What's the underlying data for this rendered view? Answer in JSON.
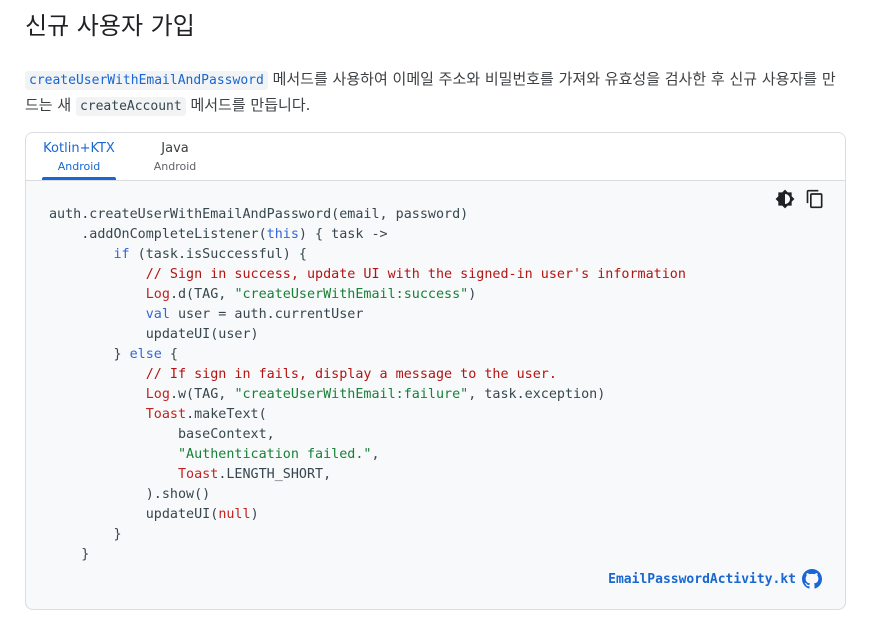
{
  "section": {
    "title": "신규 사용자 가입"
  },
  "description": {
    "code1": "createUserWithEmailAndPassword",
    "text1": " 메서드를 사용하여 이메일 주소와 비밀번호를 가져와 유효성을 검사한 후 신규 사용자를 만드는 새 ",
    "code2": "createAccount",
    "text2": " 메서드를 만듭니다."
  },
  "tabs": [
    {
      "label": "Kotlin+KTX",
      "sublabel": "Android",
      "active": true
    },
    {
      "label": "Java",
      "sublabel": "Android",
      "active": false
    }
  ],
  "toolbar": {
    "theme_icon": "dark-mode-toggle-icon",
    "copy_icon": "copy-icon"
  },
  "code": {
    "line1": "auth.createUserWithEmailAndPassword(email, password)",
    "line2a": "    .addOnCompleteListener(",
    "line2_kw": "this",
    "line2b": ") { task ->",
    "line3_kw": "if",
    "line3b": " (task.isSuccessful) {",
    "line4": "// Sign in success, update UI with the signed-in user's information",
    "line5_cls": "Log",
    "line5b": ".d(TAG, ",
    "line5_str": "\"createUserWithEmail:success\"",
    "line5c": ")",
    "line6_kw": "val",
    "line6b": " user = auth.currentUser",
    "line7": "updateUI(user)",
    "line8a": "} ",
    "line8_kw": "else",
    "line8b": " {",
    "line9": "// If sign in fails, display a message to the user.",
    "line10_cls": "Log",
    "line10b": ".w(TAG, ",
    "line10_str": "\"createUserWithEmail:failure\"",
    "line10c": ", task.exception)",
    "line11_cls": "Toast",
    "line11b": ".makeText(",
    "line12": "baseContext,",
    "line13_str": "\"Authentication failed.\"",
    "line13b": ",",
    "line14_cls": "Toast",
    "line14b": ".LENGTH_SHORT,",
    "line15": ").show()",
    "line16a": "updateUI(",
    "line16_lit": "null",
    "line16b": ")",
    "line17": "}",
    "line18": "}"
  },
  "source_link": {
    "label": "EmailPasswordActivity.kt",
    "icon": "github-icon"
  },
  "colors": {
    "accent": "#1967d2",
    "keyword": "#3367d6",
    "comment": "#c5221f",
    "string": "#188038",
    "code_bg": "#f8f9fa"
  }
}
